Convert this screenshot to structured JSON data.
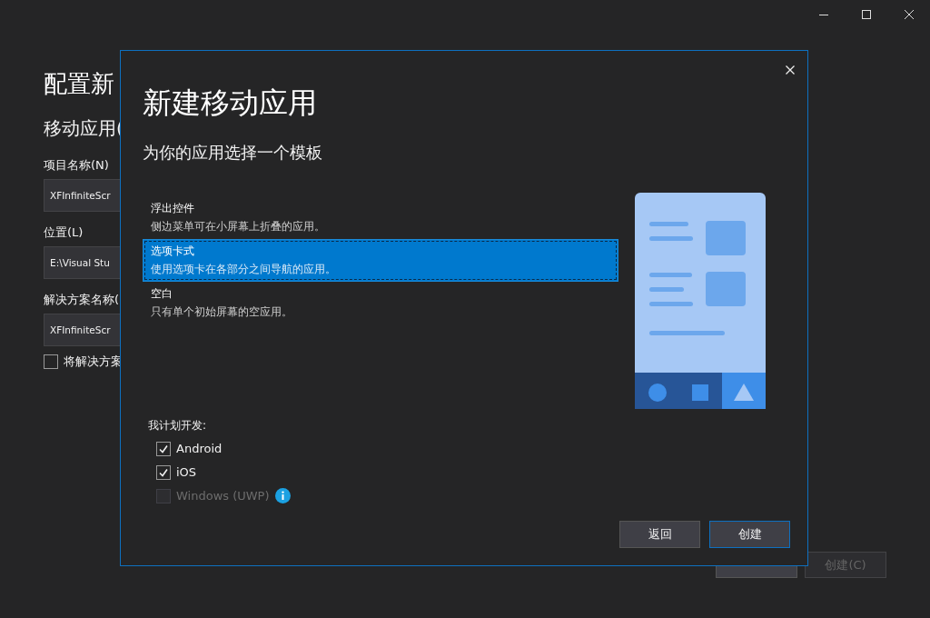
{
  "background_page": {
    "title": "配置新",
    "subtitle": "移动应用(",
    "fields": [
      {
        "label": "项目名称(N)",
        "value": "XFInfiniteScr"
      },
      {
        "label": "位置(L)",
        "value": "E:\\Visual Stu"
      },
      {
        "label": "解决方案名称(",
        "value": "XFInfiniteScr"
      }
    ],
    "checkbox": {
      "label": "将解决方案",
      "checked": false
    },
    "buttons": [
      {
        "disabled": false
      },
      {
        "label": "创建(C)",
        "disabled": true
      }
    ]
  },
  "dialog": {
    "title": "新建移动应用",
    "subtitle": "为你的应用选择一个模板",
    "templates": [
      {
        "title": "浮出控件",
        "description": "侧边菜单可在小屏幕上折叠的应用。",
        "selected": false
      },
      {
        "title": "选项卡式",
        "description": "使用选项卡在各部分之间导航的应用。",
        "selected": true
      },
      {
        "title": "空白",
        "description": "只有单个初始屏幕的空应用。",
        "selected": false
      }
    ],
    "platforms_label": "我计划开发:",
    "platforms": [
      {
        "label": "Android",
        "checked": true,
        "disabled": false,
        "info": false
      },
      {
        "label": "iOS",
        "checked": true,
        "disabled": false,
        "info": false
      },
      {
        "label": "Windows (UWP)",
        "checked": false,
        "disabled": true,
        "info": true
      }
    ],
    "buttons": [
      {
        "label": "返回",
        "primary": false
      },
      {
        "label": "创建",
        "primary": true
      }
    ]
  }
}
